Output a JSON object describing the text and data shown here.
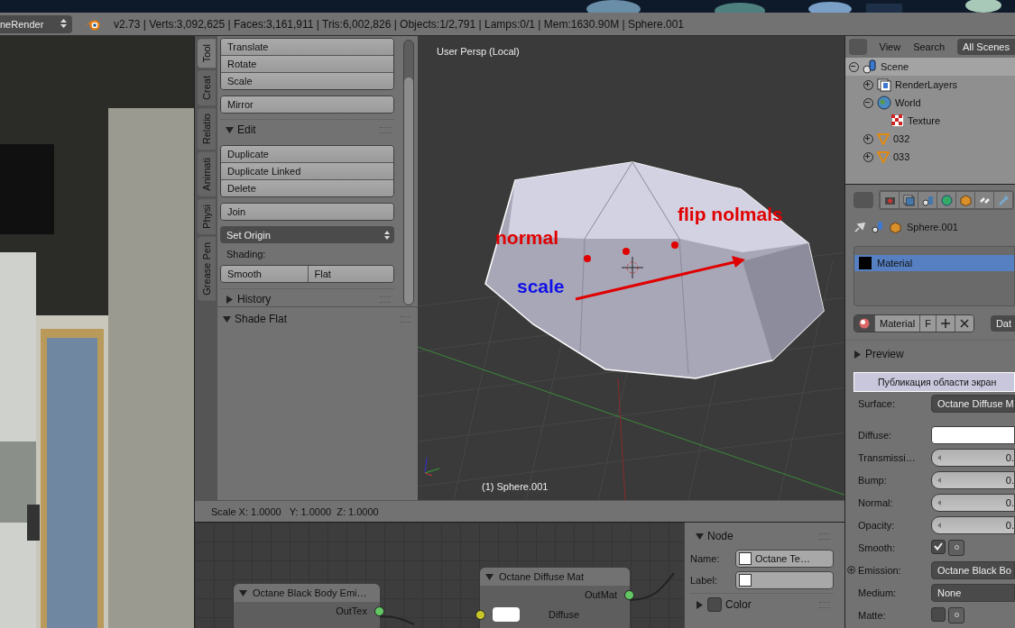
{
  "header": {
    "render_engine": "neRender",
    "stats": "v2.73 | Verts:3,092,625 | Faces:3,161,911 | Tris:6,002,826 | Objects:1/2,791 | Lamps:0/1 | Mem:1630.90M | Sphere.001"
  },
  "toolshelf": {
    "tabs": [
      {
        "label": "Tool",
        "selected": true
      },
      {
        "label": "Creat",
        "selected": false
      },
      {
        "label": "Relatio",
        "selected": false
      },
      {
        "label": "Animati",
        "selected": false
      },
      {
        "label": "Physi",
        "selected": false
      },
      {
        "label": "Grease Pen",
        "selected": false
      }
    ],
    "groups": [
      {
        "kind": "buttons",
        "items": [
          "Translate",
          "Rotate",
          "Scale"
        ]
      },
      {
        "kind": "buttons",
        "items": [
          "Mirror"
        ]
      },
      {
        "kind": "panel",
        "title": "Edit",
        "expanded": true
      },
      {
        "kind": "buttons",
        "items": [
          "Duplicate",
          "Duplicate Linked",
          "Delete"
        ]
      },
      {
        "kind": "buttons",
        "items": [
          "Join"
        ]
      },
      {
        "kind": "dropdown",
        "value": "Set Origin"
      },
      {
        "kind": "label",
        "text": "Shading:"
      },
      {
        "kind": "row",
        "items": [
          "Smooth",
          "Flat"
        ]
      },
      {
        "kind": "panel",
        "title": "History",
        "expanded": false
      }
    ],
    "operator_panel": {
      "title": "Shade Flat",
      "expanded": true
    }
  },
  "viewport": {
    "title": "User Persp (Local)",
    "object_label": "(1) Sphere.001",
    "annotations": [
      {
        "text": "normal",
        "color": "#e00000"
      },
      {
        "text": "flip nolmals",
        "color": "#e00000"
      },
      {
        "text": "scale",
        "color": "#1010e8"
      }
    ]
  },
  "operator_status": "Scale X: 1.0000   Y: 1.0000  Z: 1.0000",
  "node_editor": {
    "nodes": [
      {
        "title": "Octane Black Body Emi…",
        "sockets": [
          {
            "kind": "output",
            "name": "OutTex"
          }
        ]
      },
      {
        "title": "Octane Diffuse Mat",
        "sockets": [
          {
            "kind": "output",
            "name": "OutMat"
          },
          {
            "kind": "input",
            "name": "Diffuse"
          }
        ]
      }
    ],
    "sidebar": {
      "panels": [
        {
          "title": "Node",
          "expanded": true,
          "fields": [
            {
              "label": "Name:",
              "value": "Octane Te…"
            },
            {
              "label": "Label:"
            }
          ]
        },
        {
          "title": "Color",
          "expanded": false,
          "checked": false
        }
      ]
    }
  },
  "outliner": {
    "menus": [
      "View",
      "Search"
    ],
    "scene_filter": "All Scenes",
    "tree": [
      {
        "label": "Scene",
        "kind": "scene",
        "expanded": true,
        "selected": true,
        "children": [
          {
            "label": "RenderLayers",
            "kind": "renderlayers",
            "expanded": false,
            "selected": false
          },
          {
            "label": "World",
            "kind": "world",
            "expanded": true,
            "selected": false,
            "children": [
              {
                "label": "Texture",
                "kind": "texture",
                "selected": false
              }
            ]
          },
          {
            "label": "032",
            "kind": "object",
            "expanded": false,
            "selected": false
          },
          {
            "label": "033",
            "kind": "object",
            "expanded": false,
            "selected": false
          }
        ]
      }
    ]
  },
  "properties": {
    "breadcrumb": [
      "Sphere.001"
    ],
    "material_slots": [
      {
        "name": "Material",
        "selected": true
      }
    ],
    "material_selector": {
      "name": "Material",
      "fake_user": "F",
      "data_button": "Dat"
    },
    "panels": [
      {
        "title": "Preview",
        "expanded": false
      }
    ],
    "popup": "Публикация области экран",
    "surface": {
      "label": "Surface:",
      "value": "Octane Diffuse M"
    },
    "fields": [
      {
        "kind": "color",
        "label": "Diffuse:",
        "color": "#ffffff"
      },
      {
        "kind": "slider",
        "label": "Transmissi…",
        "value": "0."
      },
      {
        "kind": "slider",
        "label": "Bump:",
        "value": "0."
      },
      {
        "kind": "slider",
        "label": "Normal:",
        "value": "0."
      },
      {
        "kind": "slider",
        "label": "Opacity:",
        "value": "0."
      },
      {
        "kind": "checkbox",
        "label": "Smooth:",
        "checked": true
      },
      {
        "kind": "dropdown",
        "label": "Emission:",
        "value": "Octane Black Bo",
        "linked": true
      },
      {
        "kind": "dropdown",
        "label": "Medium:",
        "value": "None",
        "linked": false
      },
      {
        "kind": "checkbox",
        "label": "Matte:",
        "checked": false
      }
    ]
  }
}
